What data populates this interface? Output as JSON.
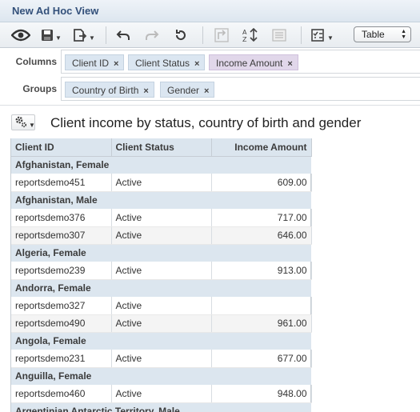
{
  "window": {
    "title": "New Ad Hoc View"
  },
  "toolbar": {
    "view_type": "Table"
  },
  "columns": {
    "label": "Columns",
    "items": [
      {
        "label": "Client ID",
        "remove": "×"
      },
      {
        "label": "Client Status",
        "remove": "×"
      },
      {
        "label": "Income Amount",
        "remove": "×"
      }
    ]
  },
  "groups": {
    "label": "Groups",
    "items": [
      {
        "label": "Country of Birth",
        "remove": "×"
      },
      {
        "label": "Gender",
        "remove": "×"
      }
    ]
  },
  "report": {
    "title": "Client income by status, country of birth and gender",
    "headers": [
      "Client ID",
      "Client Status",
      "Income Amount"
    ],
    "rows": [
      {
        "type": "group",
        "label": "Afghanistan, Female"
      },
      {
        "type": "data",
        "id": "reportsdemo451",
        "status": "Active",
        "income": "609.00"
      },
      {
        "type": "group",
        "label": "Afghanistan, Male"
      },
      {
        "type": "data",
        "id": "reportsdemo376",
        "status": "Active",
        "income": "717.00"
      },
      {
        "type": "data",
        "id": "reportsdemo307",
        "status": "Active",
        "income": "646.00"
      },
      {
        "type": "group",
        "label": "Algeria, Female"
      },
      {
        "type": "data",
        "id": "reportsdemo239",
        "status": "Active",
        "income": "913.00"
      },
      {
        "type": "group",
        "label": "Andorra, Female"
      },
      {
        "type": "data",
        "id": "reportsdemo327",
        "status": "Active",
        "income": ""
      },
      {
        "type": "data",
        "id": "reportsdemo490",
        "status": "Active",
        "income": "961.00"
      },
      {
        "type": "group",
        "label": "Angola, Female"
      },
      {
        "type": "data",
        "id": "reportsdemo231",
        "status": "Active",
        "income": "677.00"
      },
      {
        "type": "group",
        "label": "Anguilla, Female"
      },
      {
        "type": "data",
        "id": "reportsdemo460",
        "status": "Active",
        "income": "948.00"
      },
      {
        "type": "group",
        "label": "Argentinian Antarctic Territory, Male"
      }
    ]
  },
  "colors": {
    "title": "#33507a",
    "dimension_chip": "#dbe6f1",
    "measure_chip": "#e1d7ea",
    "group_row": "#dce6ef"
  },
  "icons": [
    "eye-icon",
    "save-icon",
    "export-icon",
    "undo-icon",
    "redo-icon",
    "undo-all-icon",
    "pivot-icon",
    "sort-icon",
    "page-properties-icon",
    "display-options-icon",
    "gear-icon"
  ]
}
